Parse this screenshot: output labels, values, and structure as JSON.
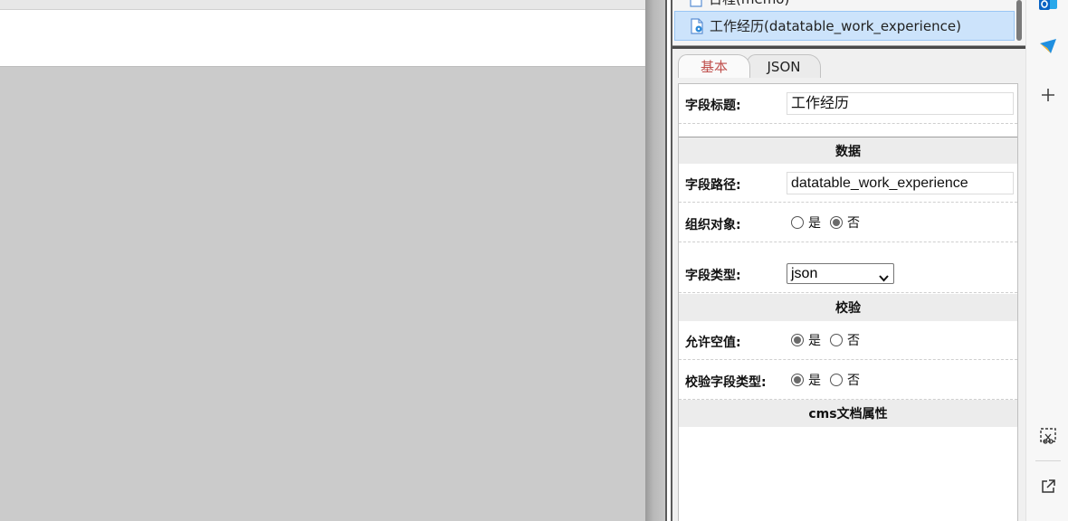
{
  "tree": {
    "prev_item_label": "日程(memo)",
    "selected_item_label": "工作经历(datatable_work_experience)"
  },
  "tabs": [
    {
      "label": "基本",
      "active": true
    },
    {
      "label": "JSON",
      "active": false
    }
  ],
  "props": {
    "field_title_label": "字段标题:",
    "field_title_value": "工作经历",
    "section_data": "数据",
    "field_path_label": "字段路径:",
    "field_path_value": "datatable_work_experience",
    "org_object_label": "组织对象:",
    "org_object_options": [
      "是",
      "否"
    ],
    "org_object_selected": "否",
    "field_type_label": "字段类型:",
    "field_type_value": "json",
    "section_validate": "校验",
    "allow_null_label": "允许空值:",
    "allow_null_options": [
      "是",
      "否"
    ],
    "allow_null_selected": "是",
    "validate_type_label": "校验字段类型:",
    "validate_type_options": [
      "是",
      "否"
    ],
    "validate_type_selected": "是",
    "section_cms": "cms文档属性"
  },
  "edge_bar": {
    "icons": [
      "outlook-icon",
      "send-icon",
      "plus-icon",
      "screenshot-icon",
      "open-external-icon"
    ]
  },
  "colors": {
    "selected_bg": "#cce3fb",
    "active_tab_text": "#c0504d",
    "canvas_bg": "#cbcbcb"
  }
}
